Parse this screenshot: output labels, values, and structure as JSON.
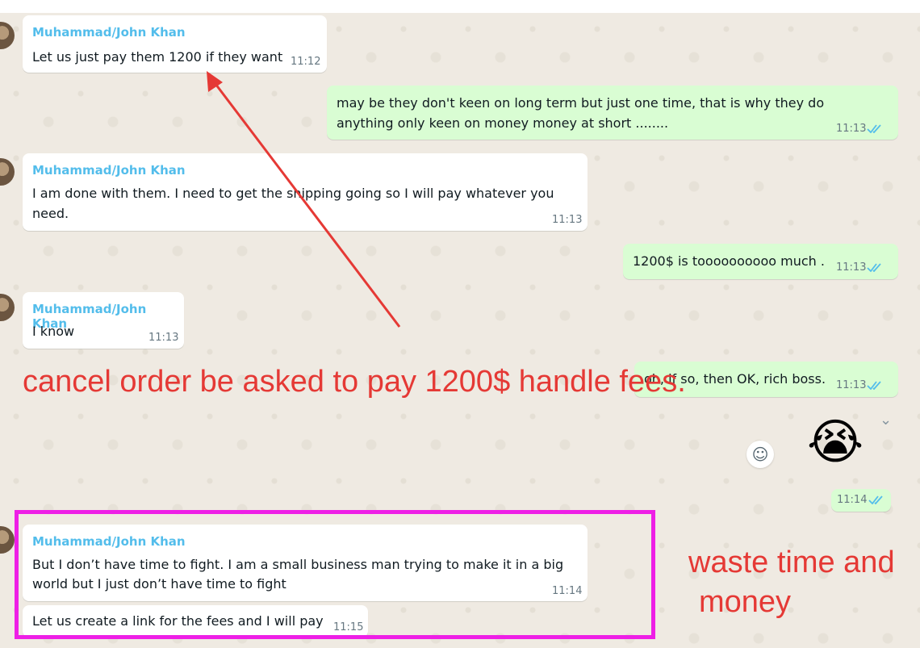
{
  "messages": [
    {
      "sender": "Muhammad/John Khan",
      "text": "Let us just pay them 1200 if they want",
      "time": "11:12"
    },
    {
      "text_1": "may be they don't keen on long term but just one time, that is why they do",
      "text_2": "anything only keen on money money at short ........",
      "time": "11:13"
    },
    {
      "sender": "Muhammad/John Khan",
      "text_1": "I am done with them. I need to get the shipping going so I will pay whatever you",
      "text_2": "need.",
      "time": "11:13"
    },
    {
      "text": "1200$ is toooooooooo  much .",
      "time": "11:13"
    },
    {
      "sender": "Muhammad/John Khan",
      "text": "I know",
      "time": "11:13"
    },
    {
      "text": "oh, if so, then OK, rich boss.",
      "time": "11:13"
    },
    {
      "emoji": "😭",
      "time": "11:14"
    },
    {
      "sender": "Muhammad/John Khan",
      "text_1": "But I don’t have time to fight. I am a small business man trying to make it in a big",
      "text_2": "world but I just don’t have time to fight",
      "time": "11:14"
    },
    {
      "text": "Let us create a link for the fees and I will pay",
      "time": "11:15"
    }
  ],
  "annotations": {
    "main": "cancel order be asked to pay 1200$ handle fees.",
    "side_1": "waste time and",
    "side_2": "money"
  },
  "colors": {
    "annotation": "#e53935",
    "highlight_box": "#ee1fe6",
    "outgoing": "#d9fdd3",
    "sender_name": "#53bdeb"
  },
  "icons": {
    "react": "smiley-icon",
    "menu": "chevron-down-icon",
    "read": "double-check-icon"
  }
}
